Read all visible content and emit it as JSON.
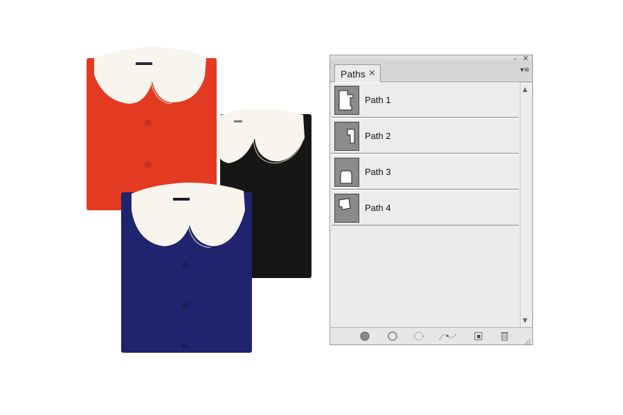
{
  "panel": {
    "tab_label": "Paths",
    "tab_close_glyph": "✕",
    "minimize_glyph": "–",
    "close_glyph": "✕",
    "menu_glyph": "▾≡",
    "paths": [
      {
        "label": "Path 1",
        "icon": "path-thumbnail"
      },
      {
        "label": "Path 2",
        "icon": "path-thumbnail"
      },
      {
        "label": "Path 3",
        "icon": "path-thumbnail"
      },
      {
        "label": "Path 4",
        "icon": "path-thumbnail"
      }
    ],
    "footer_buttons": [
      {
        "icon": "fill-path-icon"
      },
      {
        "icon": "stroke-path-icon"
      },
      {
        "icon": "load-selection-icon"
      },
      {
        "icon": "make-work-path-icon"
      },
      {
        "icon": "new-path-icon"
      },
      {
        "icon": "trash-icon"
      }
    ]
  },
  "colors": {
    "red_garment": "#e33b22",
    "black_garment": "#161616",
    "blue_garment": "#20246e",
    "collar": "#f7f5ee"
  }
}
